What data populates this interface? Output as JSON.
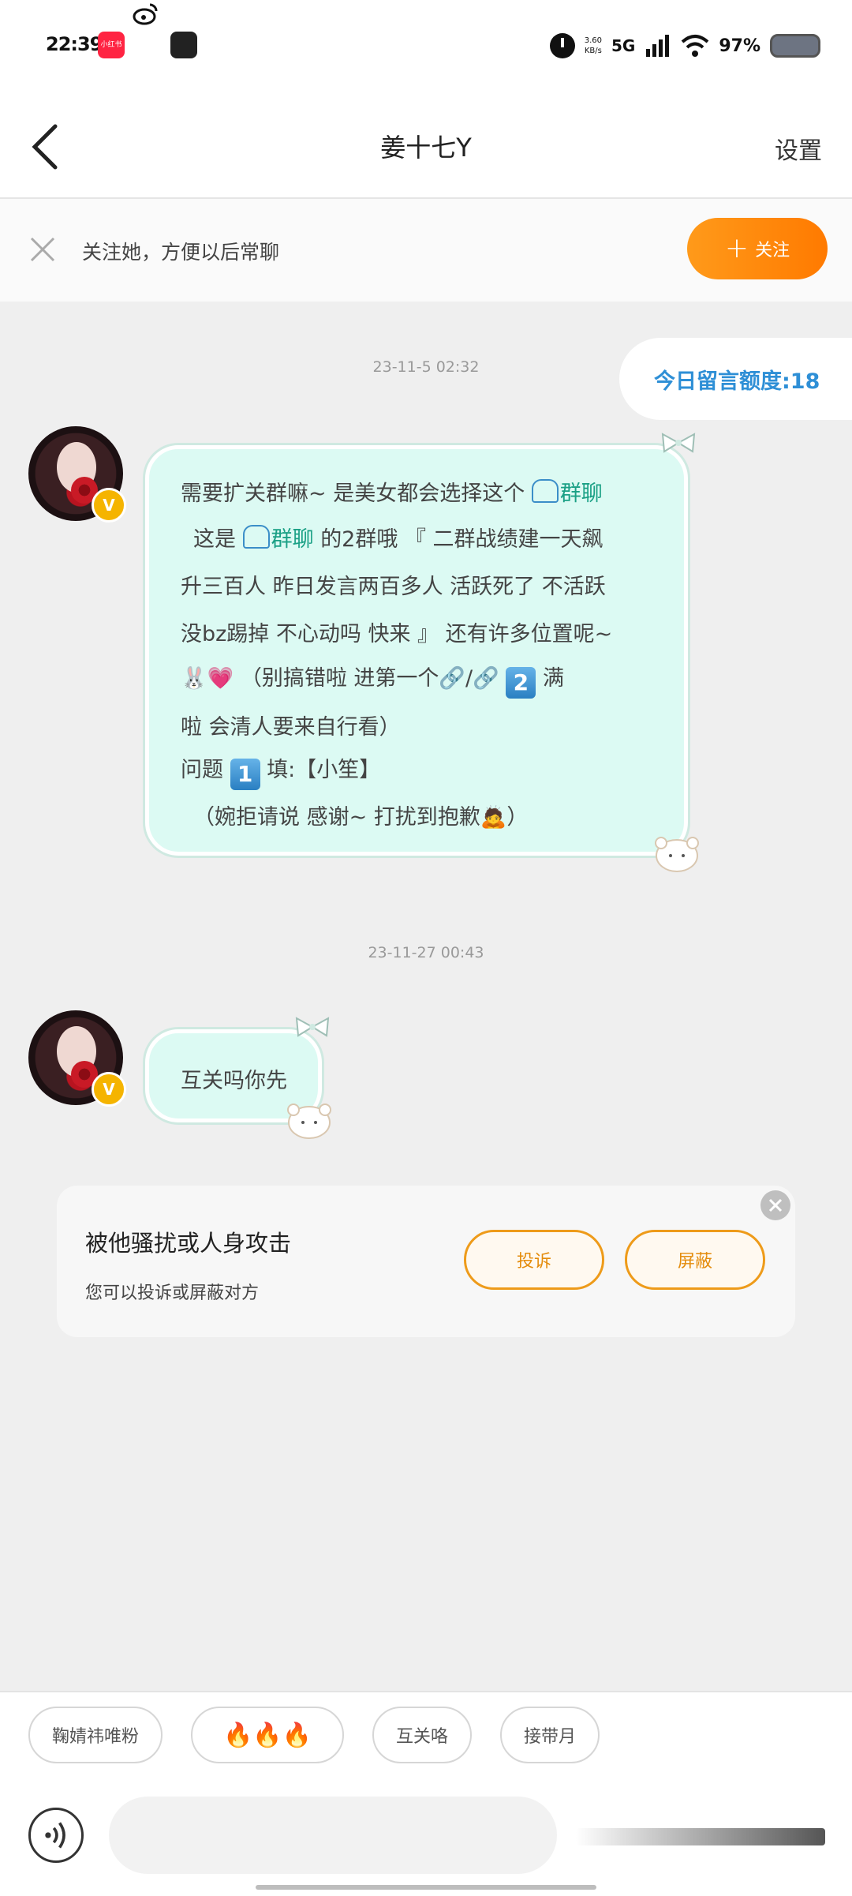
{
  "status_bar": {
    "time": "22:39",
    "xhs_label": "小红书",
    "net_speed": "3.60",
    "net_unit": "KB/s",
    "network": "5G",
    "battery": "97%"
  },
  "header": {
    "title": "姜十七Y",
    "settings": "设置"
  },
  "follow_banner": {
    "tip": "关注她，方便以后常聊",
    "button": "关注"
  },
  "quota": "今日留言额度:18",
  "messages": [
    {
      "timestamp": "23-11-5  02:32",
      "lines": [
        {
          "a": "需要扩关群嘛~  是美女都会选择这个",
          "link": "群聊"
        },
        {
          "pre": "这是",
          "link": "群聊",
          "b": "  的2群哦       『 二群战绩建一天飙"
        },
        {
          "a": "升三百人  昨日发言两百多人  活跃死了  不活跃"
        },
        {
          "a": "没bz踢掉  不心动吗  快来 』  还有许多位置呢~"
        },
        {
          "emoji1": "🐰💗",
          "a": "（别搞错啦  进第一个🔗/🔗",
          "key": "2",
          "b": "满"
        },
        {
          "a": "啦  会清人要来自行看）"
        },
        {
          "pre": "问题",
          "key": "1",
          "b": "填:【小笙】"
        },
        {
          "a": "（婉拒请说  感谢~  打扰到抱歉🙇）"
        }
      ]
    },
    {
      "timestamp": "23-11-27  00:43",
      "text": "互关吗你先"
    }
  ],
  "report_card": {
    "title": "被他骚扰或人身攻击",
    "subtitle": "您可以投诉或屏蔽对方",
    "complain": "投诉",
    "block": "屏蔽"
  },
  "quick_replies": [
    "鞠婧祎唯粉",
    "🔥🔥🔥",
    "互关咯",
    "接带月"
  ],
  "avatar_badge": "V",
  "colors": {
    "accent": "#ff8a00",
    "bubble": "#dcfaf3",
    "link": "#1aa085",
    "quota": "#2e8fd6"
  }
}
